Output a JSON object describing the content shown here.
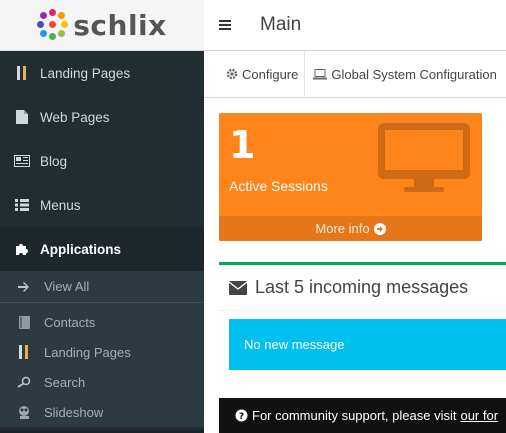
{
  "brand": {
    "logo_text": "schlix"
  },
  "sidebar": {
    "items": [
      {
        "label": "Landing Pages",
        "icon": "book-icon"
      },
      {
        "label": "Web Pages",
        "icon": "file-icon"
      },
      {
        "label": "Blog",
        "icon": "newspaper-icon"
      },
      {
        "label": "Menus",
        "icon": "list-icon"
      },
      {
        "label": "Applications",
        "icon": "puzzle-icon"
      }
    ],
    "submenu": [
      {
        "label": "View All",
        "icon": "arrow-right-icon"
      },
      {
        "label": "Contacts",
        "icon": "contact-book-icon"
      },
      {
        "label": "Landing Pages",
        "icon": "book-icon"
      },
      {
        "label": "Search",
        "icon": "search-icon"
      },
      {
        "label": "Slideshow",
        "icon": "slideshow-icon"
      }
    ]
  },
  "header": {
    "title": "Main"
  },
  "toolbar": {
    "configure_label": "Configure",
    "global_config_label": "Global System Configuration"
  },
  "sessions": {
    "count": "1",
    "label": "Active Sessions",
    "more_label": "More info"
  },
  "messages": {
    "title": "Last 5 incoming messages",
    "empty_text": "No new message"
  },
  "footer": {
    "text": "For community support, please visit",
    "link_text": "our for"
  },
  "colors": {
    "sidebar_bg": "#222d32",
    "sessions_bg": "#ff851b",
    "alert_bg": "#00c0ef",
    "accent_green": "#00a65a"
  }
}
